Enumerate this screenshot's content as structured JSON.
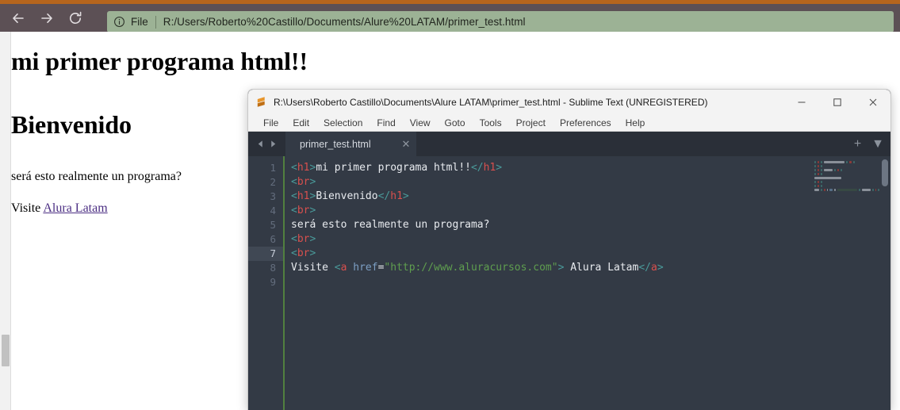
{
  "browser": {
    "nav": {
      "back_label": "Back",
      "forward_label": "Forward",
      "reload_label": "Reload"
    },
    "omnibox": {
      "scheme_label": "File",
      "url": "R:/Users/Roberto%20Castillo/Documents/Alure%20LATAM/primer_test.html",
      "info_icon": "info-circle-icon"
    },
    "colors": {
      "topstrip": "#b5651d",
      "toolbar": "#5c5055",
      "omnibox": "#9cb295"
    }
  },
  "page": {
    "heading1": "mi primer programa html!!",
    "heading2": "Bienvenido",
    "paragraph": "será esto realmente un programa?",
    "link_prefix": "Visite ",
    "link_text": "Alura Latam",
    "link_color": "#4b2e83"
  },
  "sublime": {
    "title": "R:\\Users\\Roberto Castillo\\Documents\\Alure LATAM\\primer_test.html - Sublime Text (UNREGISTERED)",
    "app_icon": "sublime-text-icon",
    "window_controls": {
      "minimize": "—",
      "maximize": "▢",
      "close": "✕"
    },
    "menu": [
      "File",
      "Edit",
      "Selection",
      "Find",
      "View",
      "Goto",
      "Tools",
      "Project",
      "Preferences",
      "Help"
    ],
    "tabs": [
      {
        "label": "primer_test.html",
        "close": "✕",
        "active": true
      }
    ],
    "tab_nav": {
      "prev": "◀",
      "next": "▶"
    },
    "tab_actions": {
      "new_tab": "+",
      "tab_menu": "▼"
    },
    "editor": {
      "active_line": 7,
      "line_numbers": [
        "1",
        "2",
        "3",
        "4",
        "5",
        "6",
        "7",
        "8",
        "9"
      ],
      "lines": [
        [
          {
            "t": "<",
            "c": "punc"
          },
          {
            "t": "h1",
            "c": "tag"
          },
          {
            "t": ">",
            "c": "punc"
          },
          {
            "t": "mi primer programa html!!",
            "c": "text"
          },
          {
            "t": "</",
            "c": "punc"
          },
          {
            "t": "h1",
            "c": "tag"
          },
          {
            "t": ">",
            "c": "punc"
          }
        ],
        [
          {
            "t": "<",
            "c": "punc"
          },
          {
            "t": "br",
            "c": "tag"
          },
          {
            "t": ">",
            "c": "punc"
          }
        ],
        [
          {
            "t": "<",
            "c": "punc"
          },
          {
            "t": "h1",
            "c": "tag"
          },
          {
            "t": ">",
            "c": "punc"
          },
          {
            "t": "Bienvenido",
            "c": "text"
          },
          {
            "t": "</",
            "c": "punc"
          },
          {
            "t": "h1",
            "c": "tag"
          },
          {
            "t": ">",
            "c": "punc"
          }
        ],
        [
          {
            "t": "<",
            "c": "punc"
          },
          {
            "t": "br",
            "c": "tag"
          },
          {
            "t": ">",
            "c": "punc"
          }
        ],
        [
          {
            "t": "será esto realmente un programa?",
            "c": "text"
          }
        ],
        [
          {
            "t": "<",
            "c": "punc"
          },
          {
            "t": "br",
            "c": "tag"
          },
          {
            "t": ">",
            "c": "punc"
          }
        ],
        [
          {
            "t": "<",
            "c": "punc"
          },
          {
            "t": "br",
            "c": "tag"
          },
          {
            "t": ">",
            "c": "punc"
          }
        ],
        [
          {
            "t": "Visite ",
            "c": "text"
          },
          {
            "t": "<",
            "c": "punc"
          },
          {
            "t": "a",
            "c": "tag"
          },
          {
            "t": " ",
            "c": "text"
          },
          {
            "t": "href",
            "c": "attr"
          },
          {
            "t": "=",
            "c": "eq"
          },
          {
            "t": "\"http://www.aluracursos.com\"",
            "c": "str"
          },
          {
            "t": ">",
            "c": "punc"
          },
          {
            "t": " Alura Latam",
            "c": "text"
          },
          {
            "t": "</",
            "c": "punc"
          },
          {
            "t": "a",
            "c": "tag"
          },
          {
            "t": ">",
            "c": "punc"
          }
        ],
        []
      ],
      "colors": {
        "background": "#333a45",
        "gutter_text": "#636d7d",
        "active_line": "#404854",
        "tag": "#d8504e",
        "punctuation": "#4a9a9a",
        "text": "#e8ebef",
        "attribute": "#7c9fc4",
        "string": "#5f9e4f",
        "fold_marker": "#51803f"
      }
    }
  }
}
